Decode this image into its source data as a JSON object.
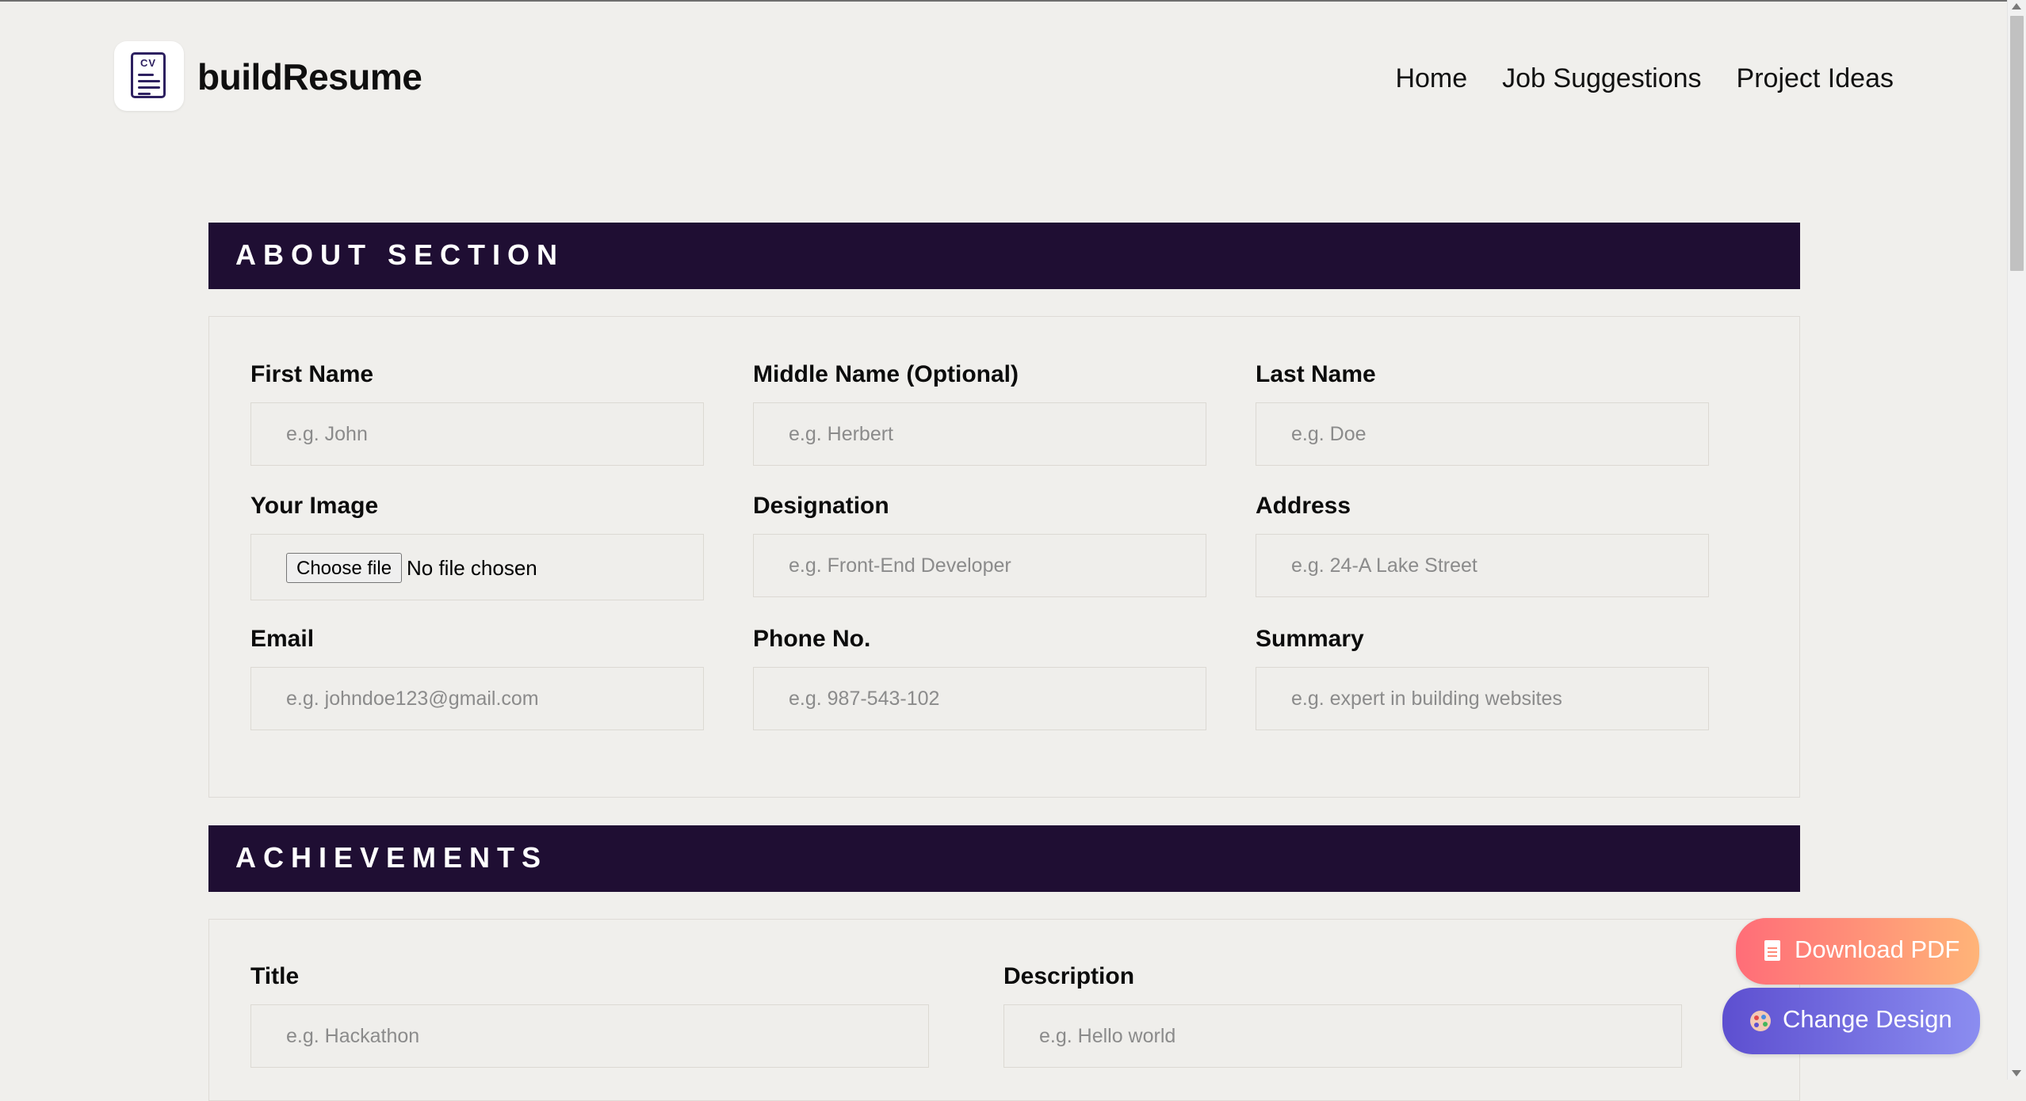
{
  "brand": {
    "name": "buildResume",
    "logo_text": "CV",
    "logo_icon": "cv-document-icon"
  },
  "nav": {
    "home": "Home",
    "jobs": "Job Suggestions",
    "projects": "Project Ideas"
  },
  "about": {
    "title": "ABOUT SECTION",
    "first_name": {
      "label": "First Name",
      "placeholder": "e.g. John"
    },
    "middle_name": {
      "label": "Middle Name (Optional)",
      "placeholder": "e.g. Herbert"
    },
    "last_name": {
      "label": "Last Name",
      "placeholder": "e.g. Doe"
    },
    "image": {
      "label": "Your Image",
      "button": "Choose file",
      "status": "No file chosen"
    },
    "designation": {
      "label": "Designation",
      "placeholder": "e.g. Front-End Developer"
    },
    "address": {
      "label": "Address",
      "placeholder": "e.g. 24-A Lake Street"
    },
    "email": {
      "label": "Email",
      "placeholder": "e.g. johndoe123@gmail.com"
    },
    "phone": {
      "label": "Phone No.",
      "placeholder": "e.g. 987-543-102"
    },
    "summary": {
      "label": "Summary",
      "placeholder": "e.g. expert in building websites"
    }
  },
  "achievements": {
    "title": "ACHIEVEMENTS",
    "title_field": {
      "label": "Title",
      "placeholder": "e.g. Hackathon"
    },
    "description": {
      "label": "Description",
      "placeholder": "e.g. Hello world"
    }
  },
  "actions": {
    "download": {
      "label": "Download PDF",
      "icon": "document-icon"
    },
    "design": {
      "label": "Change Design",
      "icon": "palette-icon"
    }
  },
  "colors": {
    "section_bar": "#1f0e33",
    "background": "#f0efec",
    "download_gradient": [
      "#ff6d78",
      "#ffb478"
    ],
    "design_gradient": [
      "#5d4fd0",
      "#8b8df0"
    ]
  }
}
